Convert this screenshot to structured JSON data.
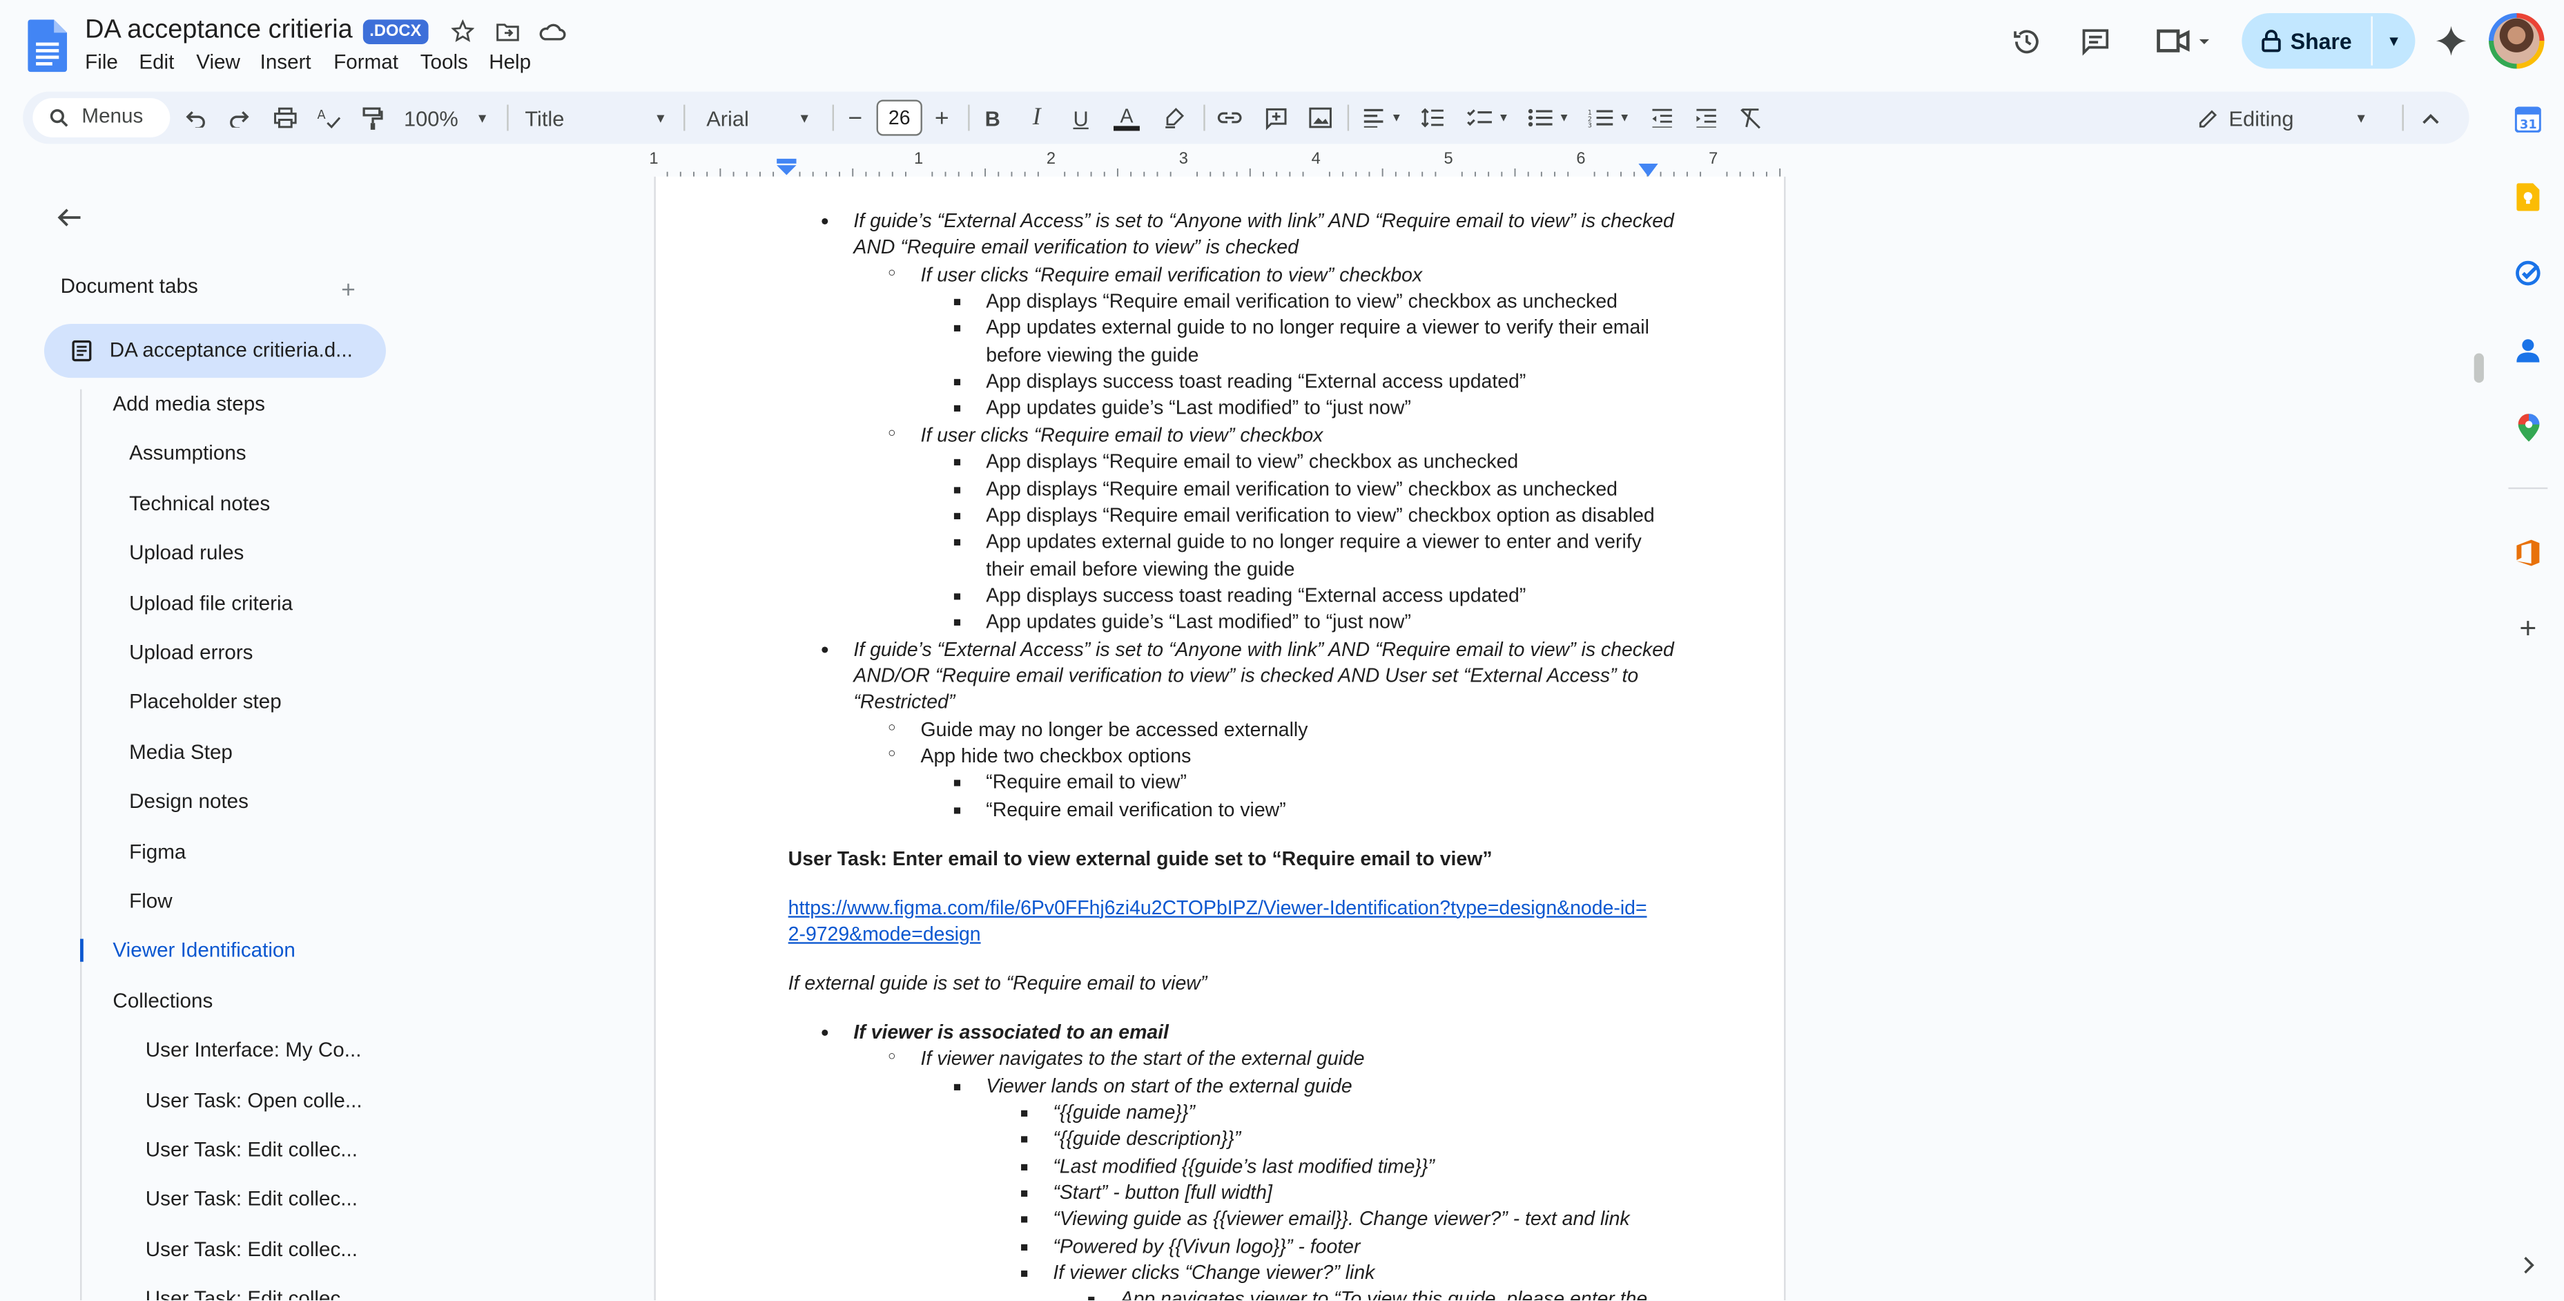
{
  "document": {
    "title": "DA acceptance critieria",
    "badge": ".DOCX"
  },
  "menubar": [
    "File",
    "Edit",
    "View",
    "Insert",
    "Format",
    "Tools",
    "Help"
  ],
  "header": {
    "share_label": "Share"
  },
  "toolbar": {
    "menus_label": "Menus",
    "zoom": "100%",
    "style": "Title",
    "font": "Arial",
    "font_size": "26",
    "mode": "Editing"
  },
  "ruler": [
    "1",
    "1",
    "2",
    "3",
    "4",
    "5",
    "6",
    "7"
  ],
  "sidebar": {
    "heading": "Document tabs",
    "tab_label": "DA acceptance critieria.d...",
    "outline": [
      {
        "label": "Add media steps",
        "level": 1
      },
      {
        "label": "Assumptions",
        "level": 2
      },
      {
        "label": "Technical notes",
        "level": 2
      },
      {
        "label": "Upload rules",
        "level": 2
      },
      {
        "label": "Upload file criteria",
        "level": 2
      },
      {
        "label": "Upload errors",
        "level": 2
      },
      {
        "label": "Placeholder step",
        "level": 2
      },
      {
        "label": "Media Step",
        "level": 2
      },
      {
        "label": "Design notes",
        "level": 2
      },
      {
        "label": "Figma",
        "level": 2
      },
      {
        "label": "Flow",
        "level": 2
      },
      {
        "label": "Viewer Identification",
        "level": 1,
        "active": true
      },
      {
        "label": "Collections",
        "level": 1
      },
      {
        "label": "User Interface: My Co...",
        "level": 3
      },
      {
        "label": "User Task: Open colle...",
        "level": 3
      },
      {
        "label": "User Task: Edit collec...",
        "level": 3
      },
      {
        "label": "User Task: Edit collec...",
        "level": 3
      },
      {
        "label": "User Task: Edit collec...",
        "level": 3
      },
      {
        "label": "User Task: Edit collec...",
        "level": 3
      }
    ]
  },
  "content": [
    {
      "text": "If guide’s “External Access” is set to “Anyone with link” AND “Require email to view” is checked",
      "level": 1,
      "bullet": "•",
      "style": "it"
    },
    {
      "text": "AND “Require email verification to view” is checked",
      "level": 1,
      "bullet": "",
      "style": "it"
    },
    {
      "text": "If user clicks “Require email verification to view” checkbox",
      "level": 2,
      "bullet": "○",
      "style": "it"
    },
    {
      "text": "App displays “Require email verification to view” checkbox as unchecked",
      "level": 3,
      "bullet": "■",
      "style": ""
    },
    {
      "text": "App updates external guide to no longer require a viewer to verify their email",
      "level": 3,
      "bullet": "■",
      "style": ""
    },
    {
      "text": "before viewing the guide",
      "level": 3,
      "bullet": "",
      "style": ""
    },
    {
      "text": "App displays success toast reading “External access updated”",
      "level": 3,
      "bullet": "■",
      "style": ""
    },
    {
      "text": "App updates guide’s “Last modified” to “just now”",
      "level": 3,
      "bullet": "■",
      "style": ""
    },
    {
      "text": "If user clicks “Require email to view” checkbox",
      "level": 2,
      "bullet": "○",
      "style": "it"
    },
    {
      "text": "App displays “Require email to view” checkbox as unchecked",
      "level": 3,
      "bullet": "■",
      "style": ""
    },
    {
      "text": "App displays “Require email verification to view” checkbox as unchecked",
      "level": 3,
      "bullet": "■",
      "style": ""
    },
    {
      "text": "App displays “Require email verification to view” checkbox option as disabled",
      "level": 3,
      "bullet": "■",
      "style": ""
    },
    {
      "text": "App updates external guide to no longer require a viewer to enter and verify",
      "level": 3,
      "bullet": "■",
      "style": ""
    },
    {
      "text": "their email before viewing the guide",
      "level": 3,
      "bullet": "",
      "style": ""
    },
    {
      "text": "App displays success toast reading “External access updated”",
      "level": 3,
      "bullet": "■",
      "style": ""
    },
    {
      "text": "App updates guide’s “Last modified” to “just now”",
      "level": 3,
      "bullet": "■",
      "style": ""
    },
    {
      "text": "If guide’s “External Access” is set to “Anyone with link” AND “Require email to view” is checked",
      "level": 1,
      "bullet": "•",
      "style": "it"
    },
    {
      "text": "AND/OR “Require email verification to view” is checked AND User set “External Access” to",
      "level": 1,
      "bullet": "",
      "style": "it"
    },
    {
      "text": "“Restricted”",
      "level": 1,
      "bullet": "",
      "style": "it"
    },
    {
      "text": "Guide may no longer be accessed externally",
      "level": 2,
      "bullet": "○",
      "style": ""
    },
    {
      "text": "App hide two checkbox options",
      "level": 2,
      "bullet": "○",
      "style": ""
    },
    {
      "text": "“Require email to view”",
      "level": 3,
      "bullet": "■",
      "style": ""
    },
    {
      "text": "“Require email verification to view”",
      "level": 3,
      "bullet": "■",
      "style": ""
    },
    {
      "text": "User Task: Enter email to view external guide set to “Require email to view”",
      "level": 0,
      "bullet": "",
      "style": "bd",
      "gap": true
    },
    {
      "text": "https://www.figma.com/file/6Pv0FFhj6zi4u2CTOPbIPZ/Viewer-Identification?type=design&node-id=",
      "level": 0,
      "bullet": "",
      "style": "lnk",
      "gap": true
    },
    {
      "text": "2-9729&mode=design",
      "level": 0,
      "bullet": "",
      "style": "lnk"
    },
    {
      "text": "If external guide is set to “Require email to view”",
      "level": 0,
      "bullet": "",
      "style": "it",
      "gap": true
    },
    {
      "text": "If viewer is associated to an email",
      "level": 1,
      "bullet": "•",
      "style": "it bd",
      "gap": true
    },
    {
      "text": "If viewer navigates to the start of the external guide",
      "level": 2,
      "bullet": "○",
      "style": "it"
    },
    {
      "text": "Viewer lands on start of the external guide",
      "level": 3,
      "bullet": "■",
      "style": "it"
    },
    {
      "text": "“{{guide name}}”",
      "level": 4,
      "bullet": "■",
      "style": "it"
    },
    {
      "text": "“{{guide description}}”",
      "level": 4,
      "bullet": "■",
      "style": "it"
    },
    {
      "text": "“Last modified {{guide’s last modified time}}”",
      "level": 4,
      "bullet": "■",
      "style": "it"
    },
    {
      "text": "“Start” - button [full width]",
      "level": 4,
      "bullet": "■",
      "style": "it"
    },
    {
      "text": "“Viewing guide as {{viewer email}}. Change viewer?” - text and link",
      "level": 4,
      "bullet": "■",
      "style": "it"
    },
    {
      "text": "“Powered by {{Vivun logo}}” - footer",
      "level": 4,
      "bullet": "■",
      "style": "it"
    },
    {
      "text": "If viewer clicks “Change viewer?” link",
      "level": 4,
      "bullet": "■",
      "style": "it"
    },
    {
      "text": "App navigates viewer to “To view this guide, please enter the",
      "level": 5,
      "bullet": "■",
      "style": "it"
    }
  ]
}
